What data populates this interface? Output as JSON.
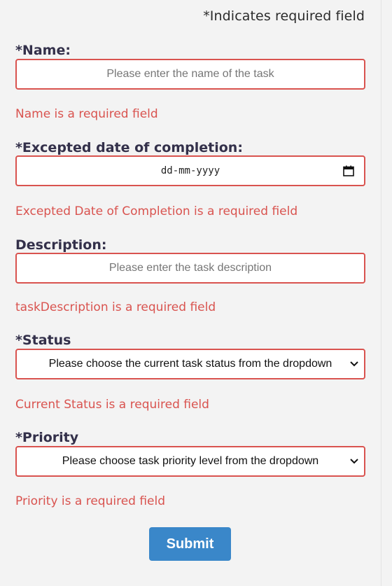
{
  "required_note": "*Indicates required field",
  "name": {
    "label": "*Name:",
    "placeholder": "Please enter the name of the task",
    "error": "Name is a required field"
  },
  "completion_date": {
    "label": "*Excepted date of completion:",
    "value_display": "dd-mm-yyyy",
    "icon": "calendar-icon",
    "error": "Excepted Date of Completion is a required field"
  },
  "description": {
    "label": "Description:",
    "placeholder": "Please enter the task description",
    "error": "taskDescription is a required field"
  },
  "status": {
    "label": "*Status",
    "selected": "Please choose the current task status from the dropdown",
    "icon": "chevron-down-icon",
    "error": "Current Status is a required field"
  },
  "priority": {
    "label": "*Priority",
    "selected": "Please choose task priority level from the dropdown",
    "icon": "chevron-down-icon",
    "error": "Priority is a required field"
  },
  "submit_label": "Submit",
  "colors": {
    "error": "#d9534f",
    "label": "#33304a",
    "button": "#3a87c9",
    "background": "#f3f3f3"
  }
}
